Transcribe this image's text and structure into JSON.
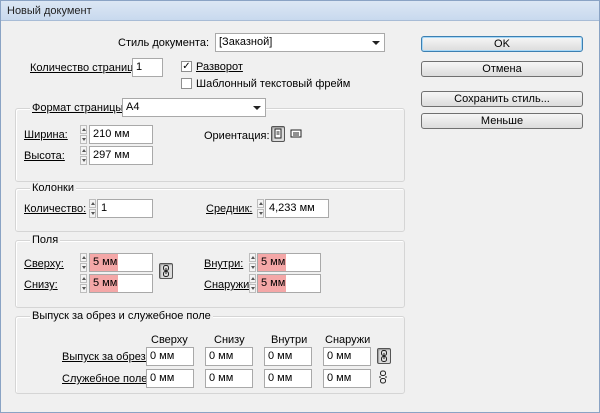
{
  "window": {
    "title": "Новый документ"
  },
  "doc_style": {
    "label": "Стиль документа:",
    "value": "[Заказной]"
  },
  "pages": {
    "label": "Количество страниц:",
    "value": "1"
  },
  "checkboxes": {
    "facing": {
      "label": "Разворот",
      "checked": true
    },
    "master_text": {
      "label": "Шаблонный текстовый фрейм",
      "checked": false
    }
  },
  "page_format": {
    "label": "Формат страницы:",
    "value": "A4",
    "width_label": "Ширина:",
    "width": "210 мм",
    "height_label": "Высота:",
    "height": "297 мм",
    "orientation_label": "Ориентация:"
  },
  "columns": {
    "title": "Колонки",
    "count_label": "Количество:",
    "count": "1",
    "gutter_label": "Средник:",
    "gutter": "4,233 мм"
  },
  "margins": {
    "title": "Поля",
    "top_label": "Сверху:",
    "top": "5 мм",
    "bottom_label": "Снизу:",
    "bottom": "5 мм",
    "inside_label": "Внутри:",
    "inside": "5 мм",
    "outside_label": "Снаружи:",
    "outside": "5 мм",
    "highlight_color": "#f4a7a7"
  },
  "bleed": {
    "title": "Выпуск за обрез и служебное поле",
    "headers": [
      "Сверху",
      "Снизу",
      "Внутри",
      "Снаружи"
    ],
    "bleed_label": "Выпуск за обрез:",
    "bleed_values": [
      "0 мм",
      "0 мм",
      "0 мм",
      "0 мм"
    ],
    "slug_label": "Служебное поле:",
    "slug_values": [
      "0 мм",
      "0 мм",
      "0 мм",
      "0 мм"
    ]
  },
  "buttons": {
    "ok": "OK",
    "cancel": "Отмена",
    "save_style": "Сохранить стиль...",
    "less": "Меньше"
  }
}
